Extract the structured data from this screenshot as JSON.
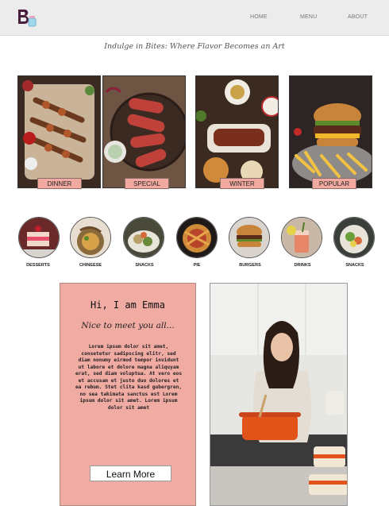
{
  "header": {
    "nav": [
      {
        "label": "HOME"
      },
      {
        "label": "MENU"
      },
      {
        "label": "ABOUT"
      }
    ]
  },
  "tagline": "Indulge in Bites: Where Flavor Becomes an Art",
  "featured": [
    {
      "label": "DINNER",
      "icon": "skewers-platter-image"
    },
    {
      "label": "SPECIAL",
      "icon": "sausage-plate-image"
    },
    {
      "label": "WINTER",
      "icon": "roast-table-image"
    },
    {
      "label": "POPULAR",
      "icon": "burger-fries-image"
    }
  ],
  "categories": [
    {
      "label": "DESSERTS"
    },
    {
      "label": "CHINEESE"
    },
    {
      "label": "SNACKS"
    },
    {
      "label": "PIE"
    },
    {
      "label": "BURGERS"
    },
    {
      "label": "DRINKS"
    },
    {
      "label": "SNACKS"
    }
  ],
  "intro": {
    "heading": "Hi, I am Emma",
    "subheading": "Nice to meet you all...",
    "body": "Lorem ipsum dolor sit amet, consetetur sadipscing elitr, sed diam nonumy eirmod tempor invidunt ut labore et dolore magna aliquyam erat, sed diam voluptua. At vero eos et accusam et justo duo dolores et ea rebum. Stet clita kasd gubergren, no sea takimata sanctus est Lorem ipsum dolor sit amet. Lorem ipsum dolor sit amet",
    "button": "Learn More"
  },
  "colors": {
    "accent": "#f0aba3",
    "header_bg": "#ececec"
  }
}
